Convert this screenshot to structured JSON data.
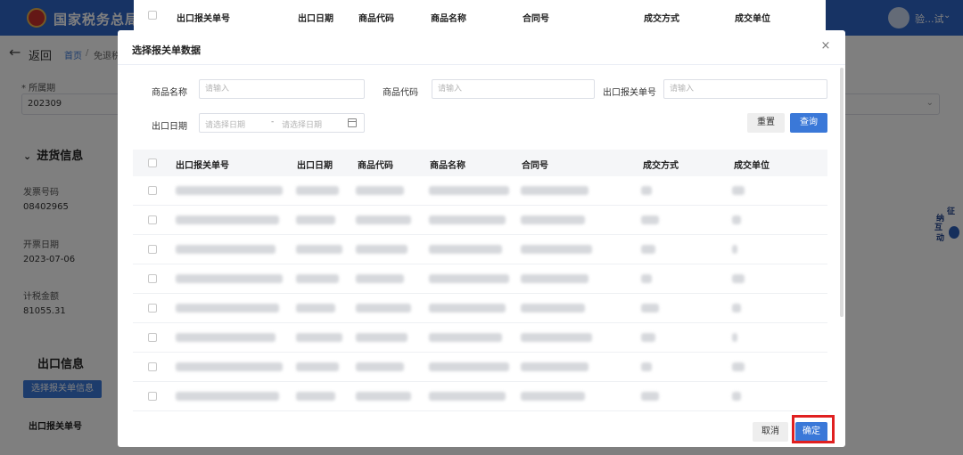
{
  "background": {
    "site_title": "国家税务总局天",
    "user_name": "验...试",
    "back_label": "返回",
    "breadcrumb": {
      "home": "首页",
      "separator": "/",
      "current": "免退税"
    },
    "period_label": "* 所属期",
    "period_value": "202309",
    "purchase_section_title": "进货信息",
    "invoice_no_label": "发票号码",
    "invoice_no_value": "08402965",
    "invoice_date_label": "开票日期",
    "invoice_date_value": "2023-07-06",
    "tax_amount_label": "计税金额",
    "tax_amount_value": "81055.31",
    "export_section_title": "出口信息",
    "select_customs_button": "选择报关单信息",
    "export_customs_no_label": "出口报关单号",
    "assistant_text": [
      "征",
      "纳",
      "互",
      "动"
    ]
  },
  "dialog": {
    "title": "选择报关单数据",
    "close_glyph": "×",
    "filters": {
      "product_name_label": "商品名称",
      "product_name_placeholder": "请输入",
      "product_code_label": "商品代码",
      "product_code_placeholder": "请输入",
      "customs_no_label": "出口报关单号",
      "customs_no_placeholder": "请输入",
      "export_date_label": "出口日期",
      "date_start_placeholder": "请选择日期",
      "date_separator": "-",
      "date_end_placeholder": "请选择日期"
    },
    "reset_button": "重置",
    "query_button": "查询",
    "table": {
      "columns": [
        "出口报关单号",
        "出口日期",
        "商品代码",
        "商品名称",
        "合同号",
        "成交方式",
        "成交单位"
      ]
    },
    "cancel_button": "取消",
    "confirm_button": "确定"
  },
  "colors": {
    "primary": "#3a78d8",
    "highlight": "#e02020",
    "topbar": "#2f66c8"
  }
}
